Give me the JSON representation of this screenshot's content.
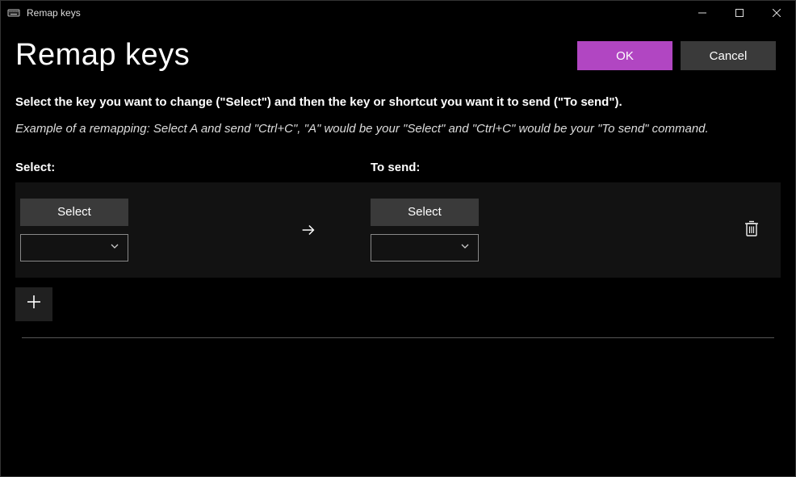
{
  "window": {
    "title": "Remap keys"
  },
  "header": {
    "title": "Remap keys",
    "ok_label": "OK",
    "cancel_label": "Cancel"
  },
  "content": {
    "instructions": "Select the key you want to change (\"Select\") and then the key or shortcut you want it to send (\"To send\").",
    "example": "Example of a remapping: Select A and send \"Ctrl+C\", \"A\" would be your \"Select\" and \"Ctrl+C\" would be your \"To send\" command.",
    "select_header": "Select:",
    "tosend_header": "To send:"
  },
  "row": {
    "select_button_label": "Select",
    "tosend_button_label": "Select",
    "select_dropdown_value": "",
    "tosend_dropdown_value": ""
  },
  "colors": {
    "accent": "#b146c2"
  }
}
